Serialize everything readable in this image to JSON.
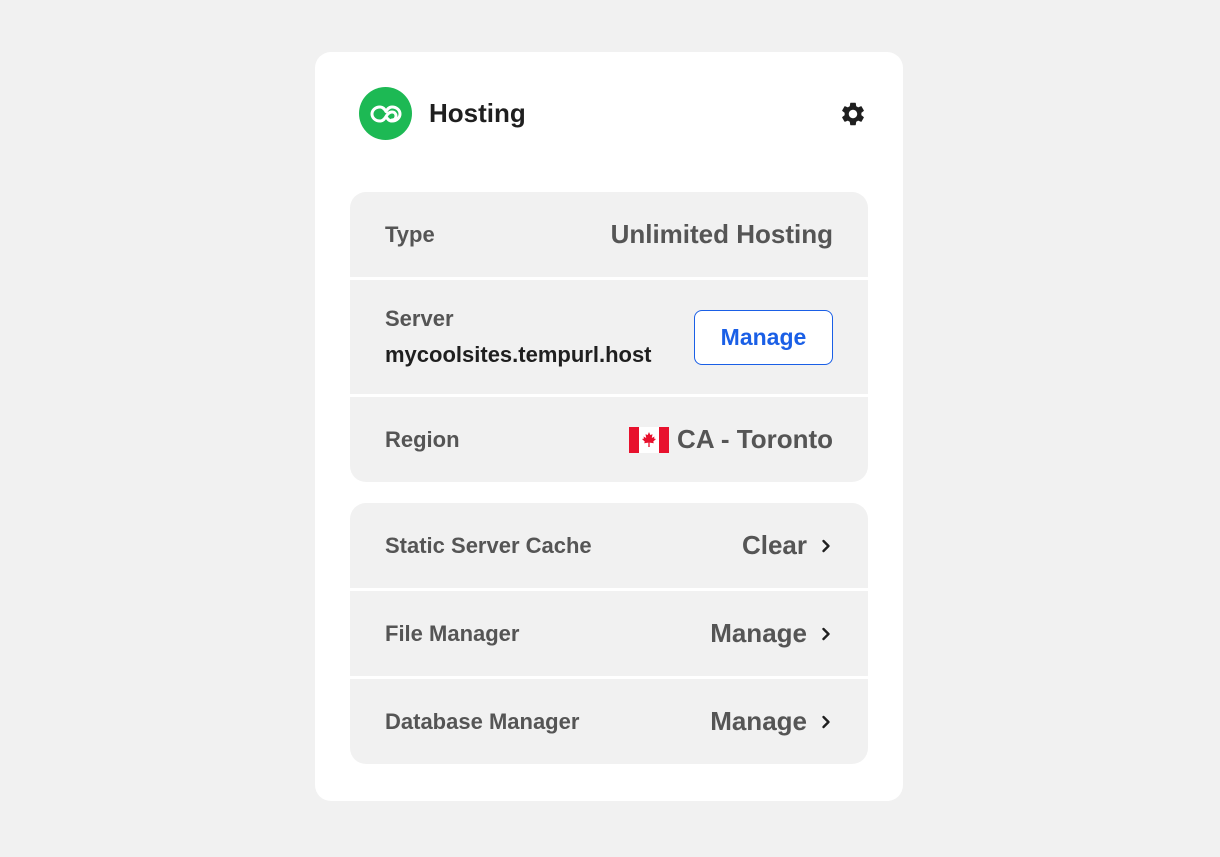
{
  "header": {
    "title": "Hosting",
    "logo_icon": "cloud-link-icon",
    "settings_icon": "gear-icon",
    "brand_color": "#1db954"
  },
  "details": {
    "type": {
      "label": "Type",
      "value": "Unlimited Hosting"
    },
    "server": {
      "label": "Server",
      "host": "mycoolsites.tempurl.host",
      "button_label": "Manage",
      "button_color": "#1a5fe6"
    },
    "region": {
      "label": "Region",
      "value": "CA - Toronto",
      "flag_icon": "canada-flag-icon"
    }
  },
  "tools": [
    {
      "label": "Static Server Cache",
      "action": "Clear",
      "icon": "chevron-right-icon"
    },
    {
      "label": "File Manager",
      "action": "Manage",
      "icon": "chevron-right-icon"
    },
    {
      "label": "Database Manager",
      "action": "Manage",
      "icon": "chevron-right-icon"
    }
  ]
}
